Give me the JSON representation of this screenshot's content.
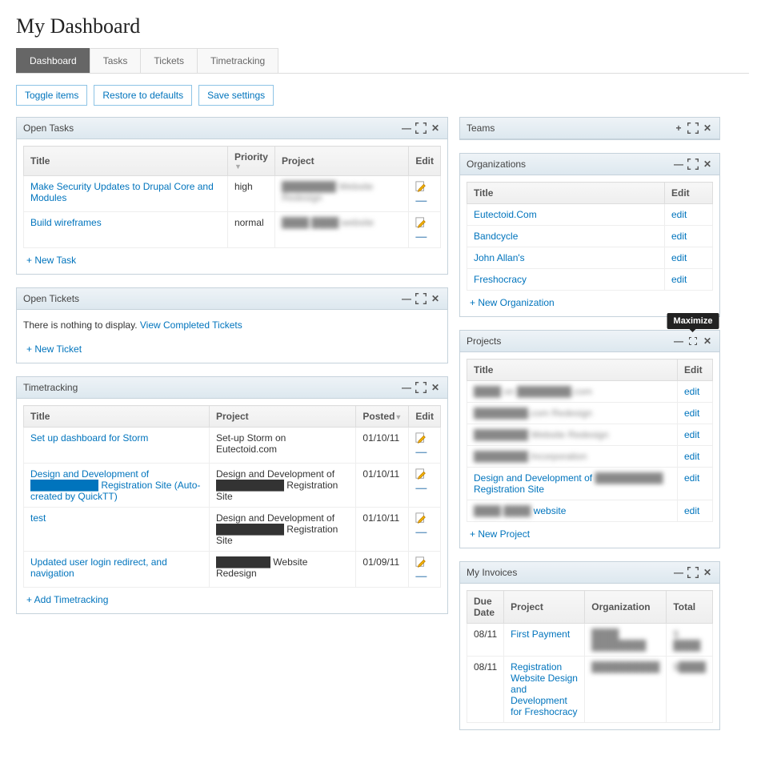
{
  "page_title": "My Dashboard",
  "tabs": [
    "Dashboard",
    "Tasks",
    "Tickets",
    "Timetracking"
  ],
  "active_tab": 0,
  "action_buttons": [
    "Toggle items",
    "Restore to defaults",
    "Save settings"
  ],
  "tooltip": "Maximize",
  "widgets": {
    "open_tasks": {
      "title": "Open Tasks",
      "columns": [
        "Title",
        "Priority",
        "Project",
        "Edit"
      ],
      "rows": [
        {
          "title": "Make Security Updates to Drupal Core and Modules",
          "priority": "high",
          "project": "████████ Website Redesign"
        },
        {
          "title": "Build wireframes",
          "priority": "normal",
          "project": "████ ████ website"
        }
      ],
      "add": "+ New Task"
    },
    "open_tickets": {
      "title": "Open Tickets",
      "empty_text": "There is nothing to display.",
      "empty_link": "View Completed Tickets",
      "add": "+ New Ticket"
    },
    "timetracking": {
      "title": "Timetracking",
      "columns": [
        "Title",
        "Project",
        "Posted",
        "Edit"
      ],
      "rows": [
        {
          "title": "Set up dashboard for Storm",
          "project": "Set-up Storm on Eutectoid.com",
          "posted": "01/10/11"
        },
        {
          "title": "Design and Development of ██████████ Registration Site (Auto-created by QuickTT)",
          "project": "Design and Development of ██████████ Registration Site",
          "posted": "01/10/11"
        },
        {
          "title": "test",
          "project": "Design and Development of ██████████ Registration Site",
          "posted": "01/10/11"
        },
        {
          "title": "Updated user login redirect, and navigation",
          "project": "████████ Website Redesign",
          "posted": "01/09/11"
        }
      ],
      "add": "+ Add Timetracking"
    },
    "teams": {
      "title": "Teams"
    },
    "organizations": {
      "title": "Organizations",
      "columns": [
        "Title",
        "Edit"
      ],
      "rows": [
        {
          "title": "Eutectoid.Com",
          "edit": "edit"
        },
        {
          "title": "Bandcycle",
          "edit": "edit"
        },
        {
          "title": "John Allan's",
          "edit": "edit"
        },
        {
          "title": "Freshocracy",
          "edit": "edit"
        }
      ],
      "add": "+ New Organization"
    },
    "projects": {
      "title": "Projects",
      "columns": [
        "Title",
        "Edit"
      ],
      "rows": [
        {
          "title": "████ on ████████.com",
          "edit": "edit",
          "blur": true
        },
        {
          "title": "████████.com Redesign",
          "edit": "edit",
          "blur": true
        },
        {
          "title": "████████ Website Redesign",
          "edit": "edit",
          "blur": true
        },
        {
          "title": "████████ Incorporation",
          "edit": "edit",
          "blur": true
        },
        {
          "title_a": "Design and Development of ",
          "title_b": "██████████",
          "title_c": " Registration Site",
          "edit": "edit"
        },
        {
          "title_a": "████ ████",
          "title_c": " website",
          "edit": "edit",
          "blur_a": true
        }
      ],
      "add": "+ New Project"
    },
    "invoices": {
      "title": "My Invoices",
      "columns": [
        "Due Date",
        "Project",
        "Organization",
        "Total"
      ],
      "rows": [
        {
          "due": "08/11",
          "project": "First Payment",
          "org": "████ ████████",
          "total": "$ ████"
        },
        {
          "due": "08/11",
          "project": "Registration Website Design and Development for Freshocracy",
          "org": "██████████",
          "total": "$████"
        }
      ]
    }
  }
}
